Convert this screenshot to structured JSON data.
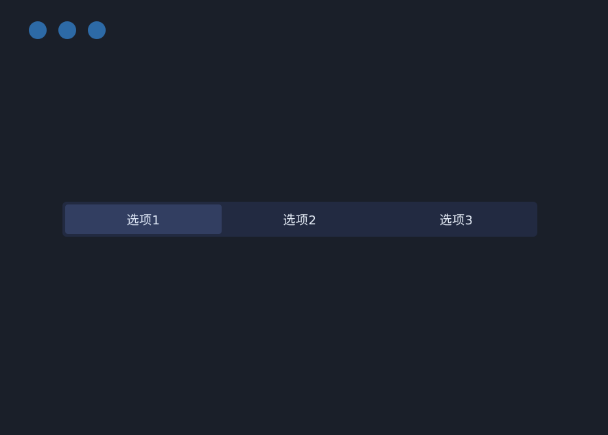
{
  "window": {
    "traffic_lights": [
      {
        "name": "dot-1",
        "color": "#2d6aa6"
      },
      {
        "name": "dot-2",
        "color": "#2d6aa6"
      },
      {
        "name": "dot-3",
        "color": "#2d6aa6"
      }
    ]
  },
  "segmented_control": {
    "selected_index": 0,
    "options": [
      {
        "label": "选项1"
      },
      {
        "label": "选项2"
      },
      {
        "label": "选项3"
      }
    ]
  },
  "colors": {
    "background": "#1a1f29",
    "control_background": "#222a41",
    "active_segment": "#323e61",
    "text": "#e6edf7"
  }
}
